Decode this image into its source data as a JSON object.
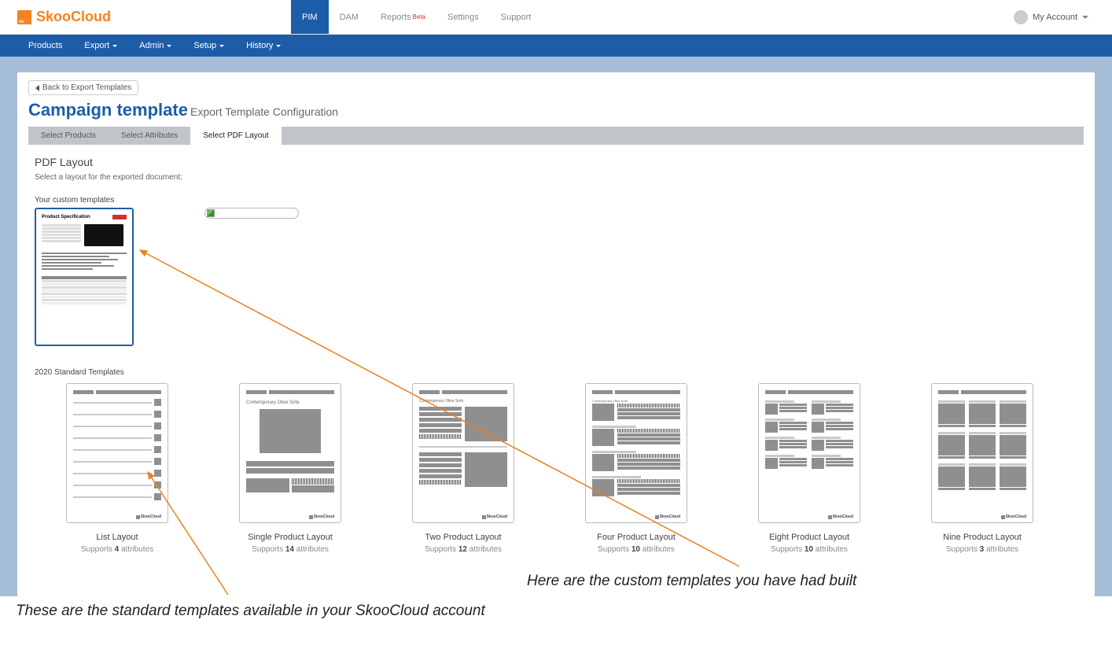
{
  "brand": "SkooCloud",
  "topnav": {
    "items": [
      {
        "label": "PIM",
        "active": true
      },
      {
        "label": "DAM"
      },
      {
        "label": "Reports",
        "beta": "Beta"
      },
      {
        "label": "Settings"
      },
      {
        "label": "Support"
      }
    ],
    "account_label": "My Account"
  },
  "subnav": {
    "items": [
      {
        "label": "Products",
        "caret": false
      },
      {
        "label": "Export",
        "caret": true
      },
      {
        "label": "Admin",
        "caret": true
      },
      {
        "label": "Setup",
        "caret": true
      },
      {
        "label": "History",
        "caret": true
      }
    ]
  },
  "page": {
    "back_label": "Back to Export Templates",
    "title": "Campaign template",
    "subtitle": "Export Template Configuration",
    "tabs": [
      {
        "label": "Select Products"
      },
      {
        "label": "Select Attributes"
      },
      {
        "label": "Select PDF Layout",
        "active": true
      }
    ],
    "section_title": "PDF Layout",
    "section_sub": "Select a layout for the exported document:",
    "custom_label": "Your custom templates",
    "custom_thumb_title": "Product Specification",
    "std_label": "2020 Standard Templates",
    "std_thumb_title": "Contemporary Olive Sofa",
    "footer_brand": "SkooCloud"
  },
  "standard_templates": [
    {
      "name": "List Layout",
      "supports_count": "4",
      "type": "list"
    },
    {
      "name": "Single Product Layout",
      "supports_count": "14",
      "type": "single"
    },
    {
      "name": "Two Product Layout",
      "supports_count": "12",
      "type": "two"
    },
    {
      "name": "Four Product Layout",
      "supports_count": "10",
      "type": "four"
    },
    {
      "name": "Eight Product Layout",
      "supports_count": "10",
      "type": "eight"
    },
    {
      "name": "Nine Product Layout",
      "supports_count": "3",
      "type": "nine"
    }
  ],
  "supports_prefix": "Supports ",
  "supports_suffix": " attributes",
  "annotations": {
    "custom": "Here are the custom templates you have had built",
    "standard": "These are the standard templates available in your SkooCloud account"
  }
}
